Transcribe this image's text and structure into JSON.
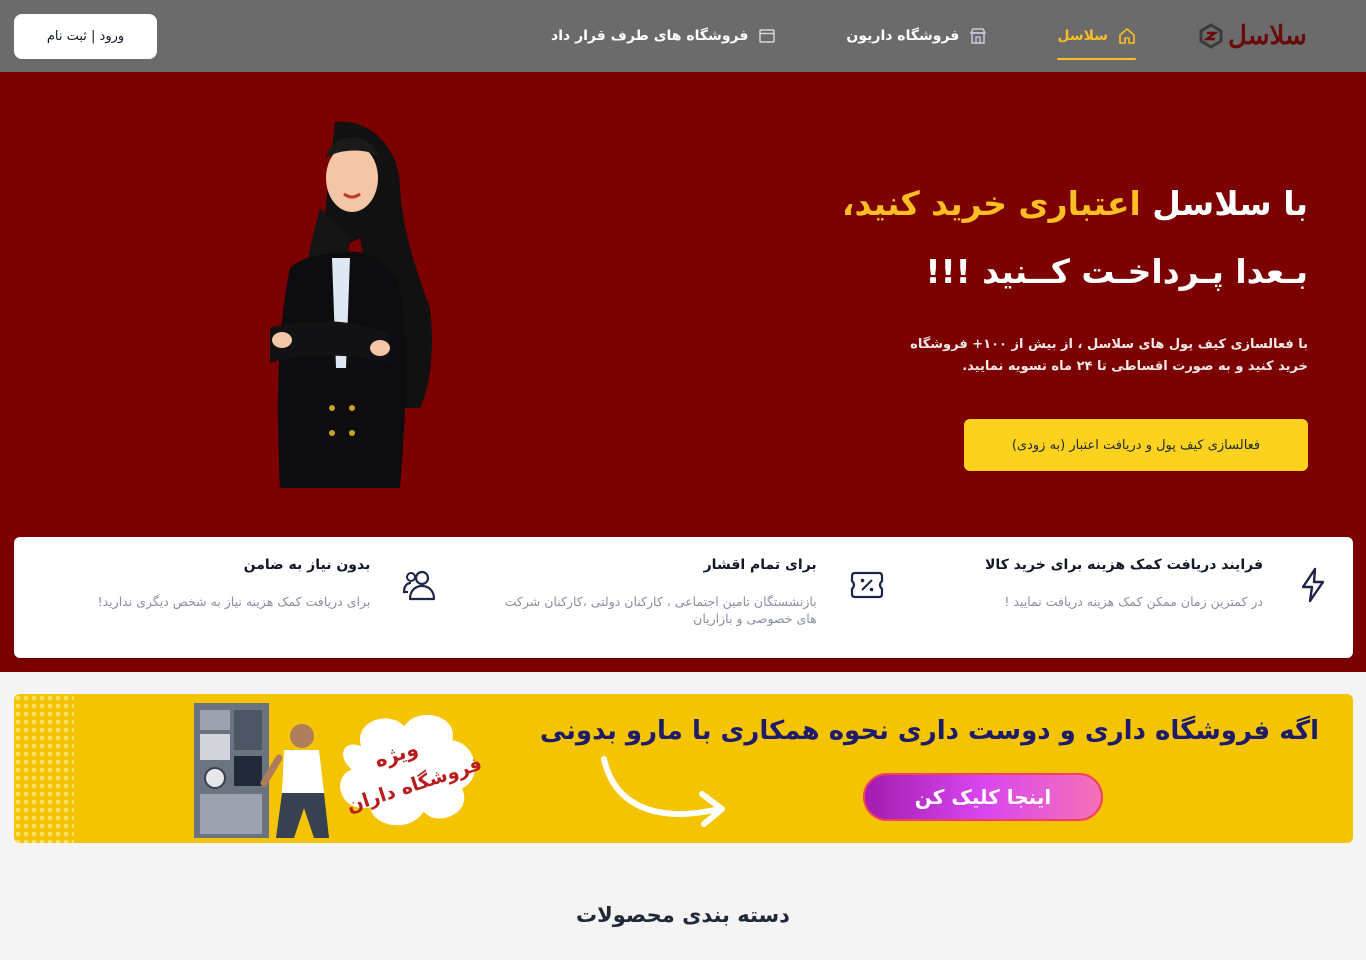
{
  "header": {
    "logo_text": "سلاسل",
    "nav": [
      {
        "label": "سلاسل",
        "icon": "home-icon",
        "active": true
      },
      {
        "label": "فروشگاه داریون",
        "icon": "store-icon",
        "active": false
      },
      {
        "label": "فروشگاه های طرف قرار داد",
        "icon": "browser-window-icon",
        "active": false
      }
    ],
    "login_label": "ورود | ثبت نام"
  },
  "hero": {
    "title_prefix": "با سلاسل ",
    "title_highlight": "اعتباری خرید کنید،",
    "title_line2": "بـعدا پـرداخـت کــنید !!!",
    "description": "با فعالسازی کیف پول های سلاسل ، از بیش از ۱۰۰+ فروشگاه خرید کنید و به صورت اقساطی تا ۲۴ ماه تسویه نمایید.",
    "cta_label": "فعالسازی کیف پول و دریافت اعتبار (به زودی)",
    "colors": {
      "background": "#7d0000",
      "highlight": "#fbbf24",
      "cta": "#fcd21e"
    }
  },
  "features": [
    {
      "icon": "lightning-icon",
      "title": "فرایند دریافت کمک هزینه برای خرید کالا",
      "desc": "در کمترین زمان ممکن کمک هزینه دریافت نمایید !"
    },
    {
      "icon": "discount-ticket-icon",
      "title": "برای تمام اقشار",
      "desc": "بازنشستگان تامین اجتماعی ، کارکنان دولتی ،کارکنان شرکت های خصوصی و بازاریان"
    },
    {
      "icon": "users-icon",
      "title": "بدون نیاز به ضامن",
      "desc": "برای دریافت کمک هزینه نیاز به شخص دیگری ندارید!"
    }
  ],
  "banner": {
    "heading": "اگه فروشگاه داری و دوست داری نحوه همکاری با مارو بدونی",
    "button_label": "اینجا کلیک کن",
    "badge_line1": "ویژه",
    "badge_line2": "فروشگاه داران",
    "colors": {
      "background": "#f5c400",
      "heading": "#1e1b6b",
      "badge_text": "#b91c1c"
    }
  },
  "section_title": "دسته بندی محصولات"
}
